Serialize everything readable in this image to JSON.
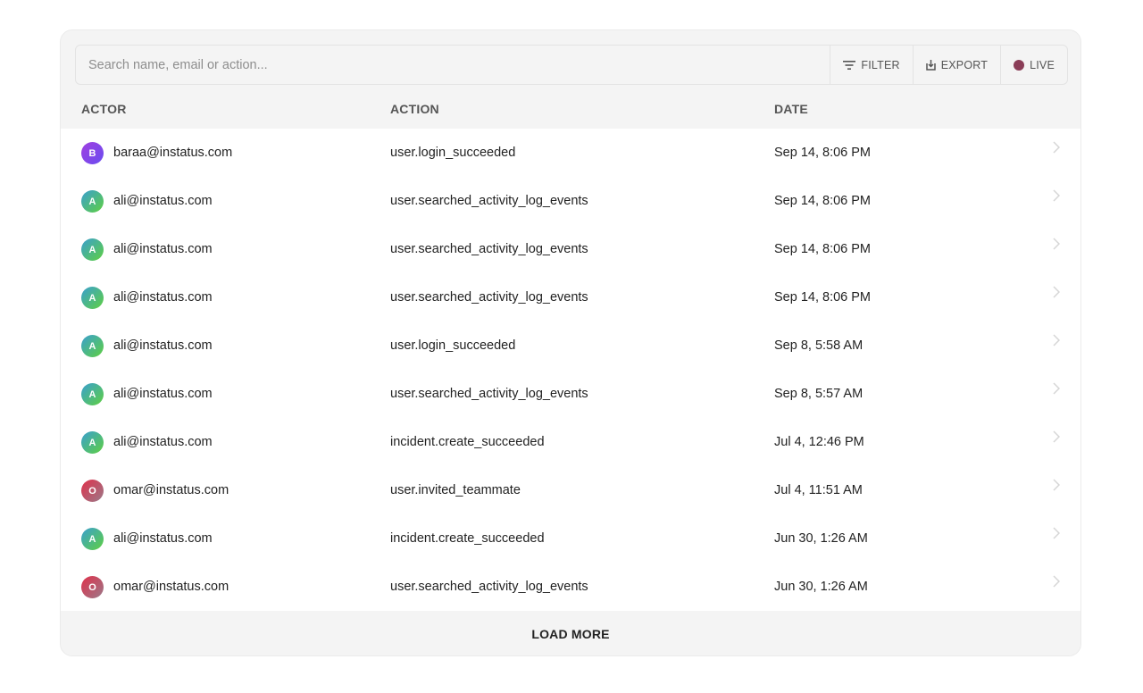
{
  "search": {
    "placeholder": "Search name, email or action..."
  },
  "toolbar": {
    "filter_label": "FILTER",
    "export_label": "EXPORT",
    "live_label": "LIVE",
    "live_color": "#8a3d57"
  },
  "table": {
    "headers": {
      "actor": "ACTOR",
      "action": "ACTION",
      "date": "DATE"
    },
    "rows": [
      {
        "initial": "B",
        "avatar_gradient": [
          "#a040e0",
          "#6a4cf0"
        ],
        "actor": "baraa@instatus.com",
        "action": "user.login_succeeded",
        "date": "Sep 14, 8:06 PM"
      },
      {
        "initial": "A",
        "avatar_gradient": [
          "#3a9fd0",
          "#5fd040"
        ],
        "actor": "ali@instatus.com",
        "action": "user.searched_activity_log_events",
        "date": "Sep 14, 8:06 PM"
      },
      {
        "initial": "A",
        "avatar_gradient": [
          "#3a9fd0",
          "#5fd040"
        ],
        "actor": "ali@instatus.com",
        "action": "user.searched_activity_log_events",
        "date": "Sep 14, 8:06 PM"
      },
      {
        "initial": "A",
        "avatar_gradient": [
          "#3a9fd0",
          "#5fd040"
        ],
        "actor": "ali@instatus.com",
        "action": "user.searched_activity_log_events",
        "date": "Sep 14, 8:06 PM"
      },
      {
        "initial": "A",
        "avatar_gradient": [
          "#3a9fd0",
          "#5fd040"
        ],
        "actor": "ali@instatus.com",
        "action": "user.login_succeeded",
        "date": "Sep 8, 5:58 AM"
      },
      {
        "initial": "A",
        "avatar_gradient": [
          "#3a9fd0",
          "#5fd040"
        ],
        "actor": "ali@instatus.com",
        "action": "user.searched_activity_log_events",
        "date": "Sep 8, 5:57 AM"
      },
      {
        "initial": "A",
        "avatar_gradient": [
          "#3a9fd0",
          "#5fd040"
        ],
        "actor": "ali@instatus.com",
        "action": "incident.create_succeeded",
        "date": "Jul 4, 12:46 PM"
      },
      {
        "initial": "O",
        "avatar_gradient": [
          "#e0304a",
          "#9a7a8a"
        ],
        "actor": "omar@instatus.com",
        "action": "user.invited_teammate",
        "date": "Jul 4, 11:51 AM"
      },
      {
        "initial": "A",
        "avatar_gradient": [
          "#3a9fd0",
          "#5fd040"
        ],
        "actor": "ali@instatus.com",
        "action": "incident.create_succeeded",
        "date": "Jun 30, 1:26 AM"
      },
      {
        "initial": "O",
        "avatar_gradient": [
          "#e0304a",
          "#9a7a8a"
        ],
        "actor": "omar@instatus.com",
        "action": "user.searched_activity_log_events",
        "date": "Jun 30, 1:26 AM"
      }
    ]
  },
  "footer": {
    "load_more_label": "LOAD MORE"
  },
  "icons": {
    "filter": "filter-icon",
    "export": "export-icon",
    "live": "live-dot-icon",
    "row": "chevron-right-icon"
  }
}
